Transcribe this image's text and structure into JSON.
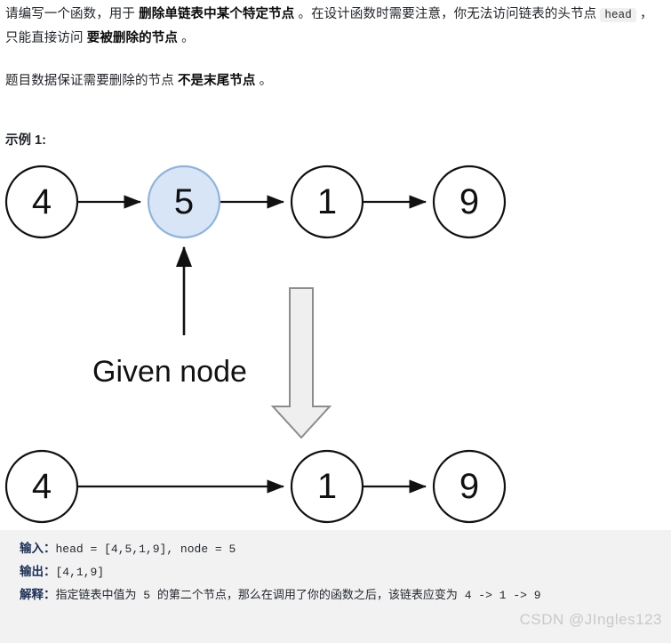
{
  "statement": {
    "p1_seg1": "请编写一个函数，用于 ",
    "p1_bold1": "删除单链表中某个特定节点",
    "p1_seg2": " 。在设计函数时需要注意，你无法访问链表的头节点 ",
    "p1_code": "head",
    "p1_seg3": " ，只能直接访问 ",
    "p1_bold2": "要被删除的节点",
    "p1_seg4": " 。",
    "p2_seg1": "题目数据保证需要删除的节点 ",
    "p2_bold1": "不是末尾节点",
    "p2_seg2": " 。"
  },
  "example_label": "示例 1:",
  "diagram": {
    "before_nodes": [
      "4",
      "5",
      "1",
      "9"
    ],
    "after_nodes": [
      "4",
      "1",
      "9"
    ],
    "highlighted_node": "5",
    "annotation": "Given node",
    "highlight_fill": "#d7e5f7",
    "highlight_stroke": "#8fb4dd",
    "node_stroke": "#111111",
    "block_arrow_fill": "#efefef",
    "block_arrow_stroke": "#8c8c8c"
  },
  "example": {
    "input_key": "输入：",
    "input_value": "head = [4,5,1,9], node = 5",
    "output_key": "输出：",
    "output_value": "[4,1,9]",
    "explain_key": "解释：",
    "explain_value": "指定链表中值为 5 的第二个节点，那么在调用了你的函数之后，该链表应变为 4 -> 1 -> 9"
  },
  "watermark": "CSDN @JIngles123"
}
